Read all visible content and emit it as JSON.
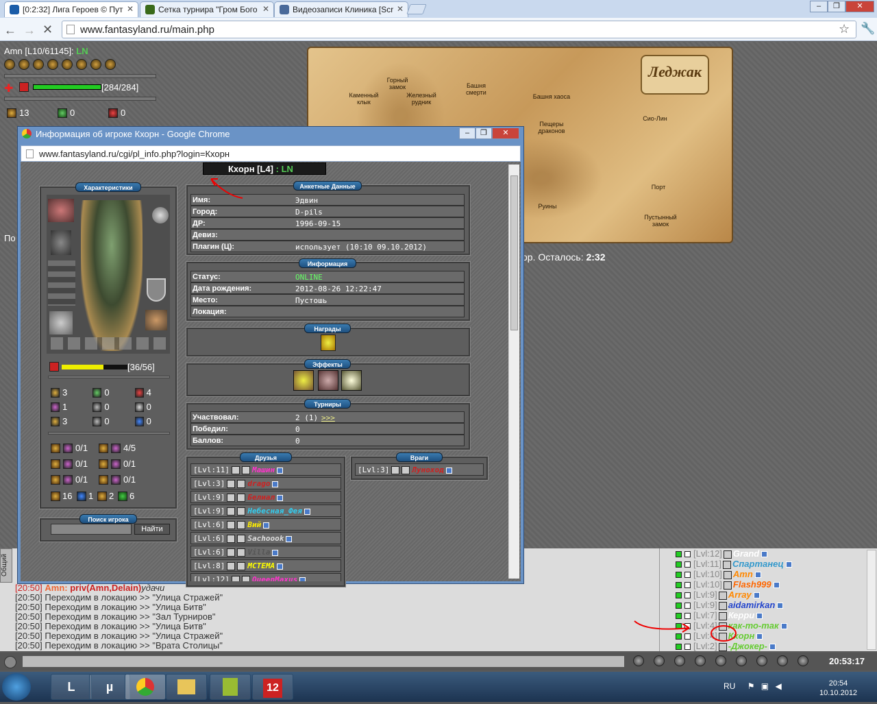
{
  "browser": {
    "tabs": [
      {
        "label": "[0:2:32] Лига Героев © Пут",
        "active": true
      },
      {
        "label": "Сетка турнира \"Гром Бого"
      },
      {
        "label": "Видеозаписи Клиника [Scr"
      }
    ],
    "url": "www.fantasyland.ru/main.php"
  },
  "character": {
    "name": "Amn [L10/61145]:",
    "flag": "LN",
    "hp": "[284/284]",
    "hp_fraction": 1.0,
    "stats": [
      "13",
      "0",
      "0"
    ],
    "partial_label": "По"
  },
  "map": {
    "title": "Леджак",
    "towns": [
      "Горный замок",
      "Железный рудник",
      "Каменный клык",
      "Башня смерти",
      "Башня хаоса",
      "Пещеры драконов",
      "Сио-Лин",
      "Порт",
      "Руины",
      "Пустынный замок"
    ],
    "timer_prefix": "ор. Осталось:",
    "timer_value": "2:32"
  },
  "popup": {
    "window_title": "Информация об игроке Кхорн - Google Chrome",
    "url": "www.fantasyland.ru/cgi/pl_info.php?login=Кхорн",
    "player_name": "Кхорн [L4]",
    "player_flag": ": LN",
    "sections": {
      "characteristics": "Характеристики",
      "profile": "Анкетные Данные",
      "info": "Информация",
      "awards": "Награды",
      "effects": "Эффекты",
      "tournaments": "Турниры",
      "friends": "Друзья",
      "enemies": "Враги",
      "search": "Поиск игрока"
    },
    "profile_rows": [
      {
        "k": "Имя:",
        "v": "Эдвин"
      },
      {
        "k": "Город:",
        "v": "D-pils"
      },
      {
        "k": "ДР:",
        "v": "1996-09-15"
      },
      {
        "k": "Девиз:",
        "v": ""
      },
      {
        "k": "Плагин (Ц):",
        "v": "использует (10:10 09.10.2012)"
      }
    ],
    "info_rows": [
      {
        "k": "Статус:",
        "v": "ONLINE"
      },
      {
        "k": "Дата рождения:",
        "v": "2012-08-26 12:22:47"
      },
      {
        "k": "Место:",
        "v": "Пустошь"
      },
      {
        "k": "Локация:",
        "v": ""
      }
    ],
    "tournament_rows": [
      {
        "k": "Участвовал:",
        "v": "2 (1)",
        "link": ">>>"
      },
      {
        "k": "Победил:",
        "v": "0"
      },
      {
        "k": "Баллов:",
        "v": "0"
      }
    ],
    "hp": "[36/56]",
    "hp_fraction": 0.64,
    "char_stats": [
      [
        "3",
        "0",
        "4"
      ],
      [
        "1",
        "0",
        "0"
      ],
      [
        "3",
        "0",
        "0"
      ]
    ],
    "skills": [
      [
        "0/1",
        "4/5"
      ],
      [
        "0/1",
        "0/1"
      ],
      [
        "0/1",
        "0/1"
      ]
    ],
    "bottom_stats": [
      "16",
      "1",
      "2",
      "6"
    ],
    "search_button": "Найти",
    "friends": [
      {
        "lvl": "[Lvl:11]",
        "name": "Машин",
        "color": "#ff33cc"
      },
      {
        "lvl": "[Lvl:3]",
        "name": "drago",
        "color": "#cc2222"
      },
      {
        "lvl": "[Lvl:9]",
        "name": "Белиал",
        "color": "#cc2222"
      },
      {
        "lvl": "[Lvl:9]",
        "name": "Небесная_Фея",
        "color": "#33ccee"
      },
      {
        "lvl": "[Lvl:6]",
        "name": "Вий",
        "color": "#ffee00"
      },
      {
        "lvl": "[Lvl:6]",
        "name": "Sachoook",
        "color": "#dddddd"
      },
      {
        "lvl": "[Lvl:6]",
        "name": "Villa",
        "color": "#555555"
      },
      {
        "lvl": "[Lvl:8]",
        "name": "МСТЕМА",
        "color": "#ffff00"
      },
      {
        "lvl": "[Lvl:12]",
        "name": "QueenMaxus",
        "color": "#ff33cc"
      }
    ],
    "enemies": [
      {
        "lvl": "[Lvl:3]",
        "name": "Луноход",
        "color": "#cc2222"
      }
    ]
  },
  "chat": {
    "tab": "Общий",
    "lines": [
      {
        "time": "[20:50]",
        "who": "Amn:",
        "cmd": "priv(Amn,Delain)",
        "text": "удачи"
      },
      {
        "time": "[20:50]",
        "text": "Переходим в локацию >> \"Улица Стражей\""
      },
      {
        "time": "[20:50]",
        "text": "Переходим в локацию >> \"Улица Битв\""
      },
      {
        "time": "[20:50]",
        "text": "Переходим в локацию >> \"Зал Турниров\""
      },
      {
        "time": "[20:50]",
        "text": "Переходим в локацию >> \"Улица Битв\""
      },
      {
        "time": "[20:50]",
        "text": "Переходим в локацию >> \"Улица Стражей\""
      },
      {
        "time": "[20:50]",
        "text": "Переходим в локацию >> \"Врата Столицы\""
      }
    ],
    "players": [
      {
        "lvl": "[Lvl:12]",
        "name": "Grand",
        "color": "#ffffff"
      },
      {
        "lvl": "[Lvl:11]",
        "name": "Спартанец",
        "color": "#3399cc"
      },
      {
        "lvl": "[Lvl:10]",
        "name": "Amn",
        "color": "#ff8800"
      },
      {
        "lvl": "[Lvl:10]",
        "name": "Flash999",
        "color": "#ff6600"
      },
      {
        "lvl": "[Lvl:9]",
        "name": "Array",
        "color": "#ff8800"
      },
      {
        "lvl": "[Lvl:9]",
        "name": "aidamirkan",
        "color": "#2244cc"
      },
      {
        "lvl": "[Lvl:7]",
        "name": "Керри",
        "color": "#ffffff"
      },
      {
        "lvl": "[Lvl:4]",
        "name": "как-то-так",
        "color": "#66cc33"
      },
      {
        "lvl": "[Lvl:4]",
        "name": "Кхорн",
        "color": "#66cc33"
      },
      {
        "lvl": "[Lvl:2]",
        "name": "-Джокер-",
        "color": "#66cc33"
      }
    ],
    "clock": "20:53:17"
  },
  "taskbar": {
    "lang": "RU",
    "time": "20:54",
    "date": "10.10.2012",
    "app_badge": "12"
  }
}
